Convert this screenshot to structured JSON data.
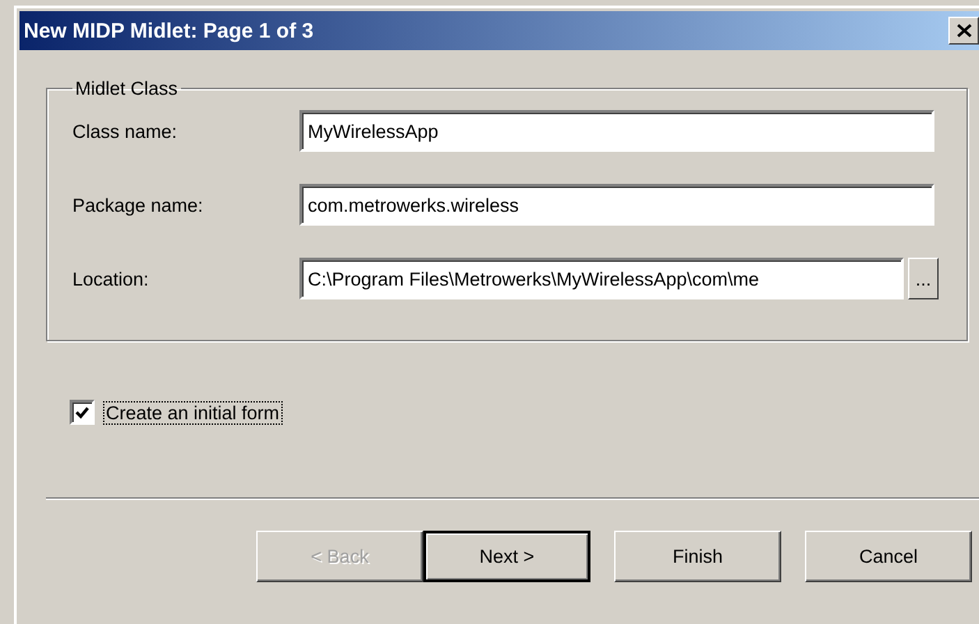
{
  "window": {
    "title": "New MIDP Midlet: Page 1 of 3"
  },
  "group": {
    "title": "Midlet Class",
    "fields": [
      {
        "label": "Class name:",
        "value": "MyWirelessApp"
      },
      {
        "label": "Package name:",
        "value": "com.metrowerks.wireless"
      },
      {
        "label": "Location:",
        "value": "C:\\Program Files\\Metrowerks\\MyWirelessApp\\com\\me",
        "browse": "..."
      }
    ]
  },
  "checkbox": {
    "label": "Create an initial form",
    "checked": true
  },
  "buttons": [
    {
      "label": "< Back",
      "disabled": true,
      "default": false
    },
    {
      "label": "Next >",
      "disabled": false,
      "default": true
    },
    {
      "label": "Finish",
      "disabled": false,
      "default": false
    },
    {
      "label": "Cancel",
      "disabled": false,
      "default": false
    }
  ]
}
